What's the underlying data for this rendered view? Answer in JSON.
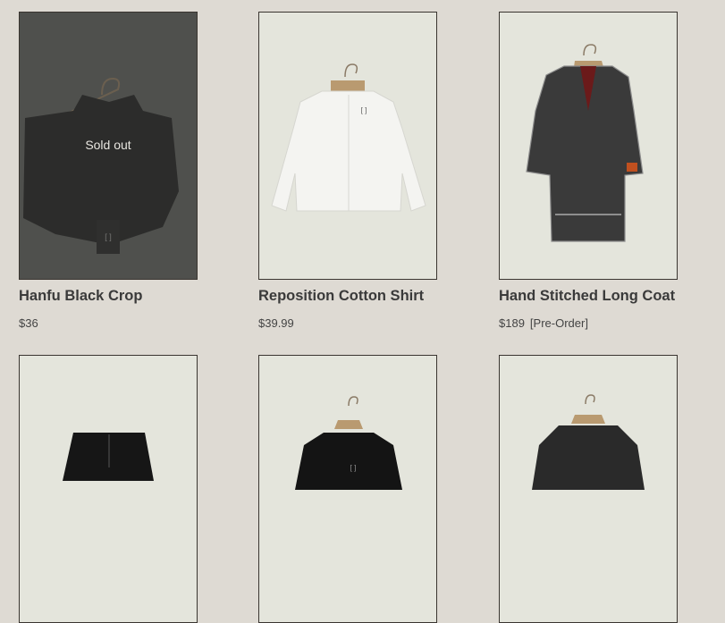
{
  "products": [
    {
      "title": "Hanfu Black Crop",
      "price": "$36",
      "badge": "",
      "status": "Sold out"
    },
    {
      "title": "Reposition Cotton Shirt",
      "price": "$39.99",
      "badge": "",
      "status": ""
    },
    {
      "title": "Hand Stitched Long Coat",
      "price": "$189",
      "badge": "[Pre-Order]",
      "status": ""
    },
    {
      "title": "",
      "price": "",
      "badge": "",
      "status": ""
    },
    {
      "title": "",
      "price": "",
      "badge": "",
      "status": ""
    },
    {
      "title": "",
      "price": "",
      "badge": "",
      "status": ""
    }
  ],
  "colors": {
    "page_bg": "#dedad3",
    "card_bg": "#e4e5dc",
    "border": "#3a3530"
  }
}
